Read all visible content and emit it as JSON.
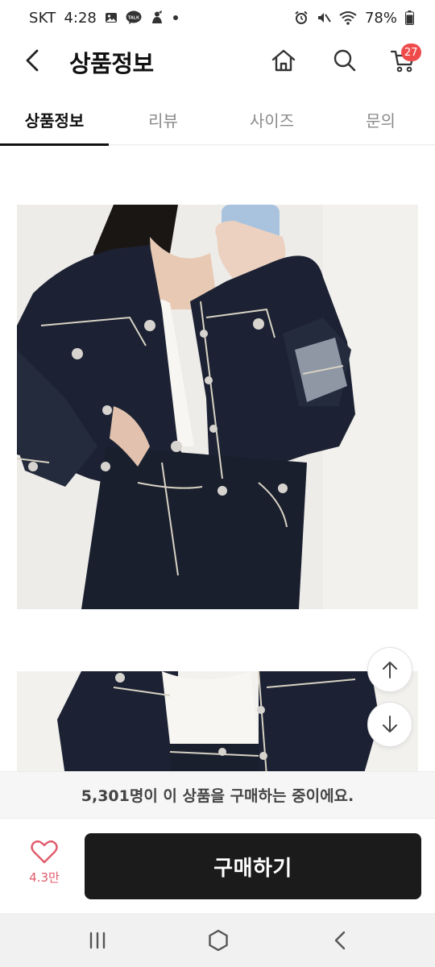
{
  "status_bar": {
    "carrier": "SKT",
    "time": "4:28",
    "battery": "78%",
    "left_icons": [
      "gallery-icon",
      "talk-icon",
      "notification-icon",
      "dot-icon"
    ],
    "right_icons": [
      "alarm-icon",
      "mute-icon",
      "wifi-icon",
      "battery-icon"
    ]
  },
  "header": {
    "title": "상품정보",
    "cart_count": "27"
  },
  "tabs": [
    {
      "label": "상품정보",
      "active": true
    },
    {
      "label": "리뷰",
      "active": false
    },
    {
      "label": "사이즈",
      "active": false
    },
    {
      "label": "문의",
      "active": false
    }
  ],
  "buyers_banner": "5,301명이 이 상품을 구매하는 중이에요.",
  "like": {
    "count": "4.3만"
  },
  "buy_button": "구매하기",
  "colors": {
    "accent_badge": "#ef4b4b",
    "buy_button_bg": "#1b1b1b",
    "like_heart": "#e05a6b",
    "denim": "#1c2233",
    "stitch": "#d8d2c4",
    "background": "#eeece9"
  },
  "icons": {
    "back": "chevron-left-icon",
    "home": "home-icon",
    "search": "search-icon",
    "cart": "cart-icon",
    "scroll_up": "arrow-up-icon",
    "scroll_down": "arrow-down-icon",
    "like": "heart-icon",
    "nav_recent": "recent-apps-icon",
    "nav_home": "hexagon-home-icon",
    "nav_back": "nav-back-icon"
  }
}
